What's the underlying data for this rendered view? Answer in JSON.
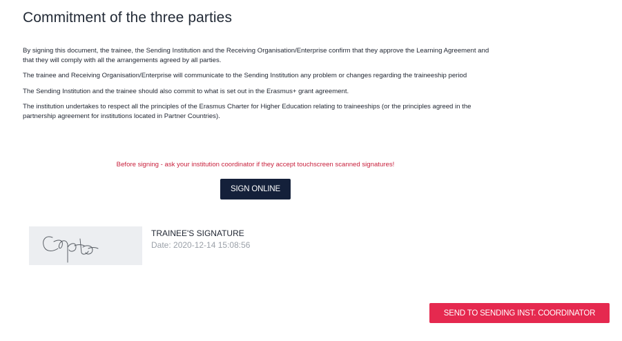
{
  "section": {
    "title": "Commitment of the three parties",
    "paragraphs": [
      "By signing this document, the trainee, the Sending Institution and the Receiving Organisation/Enterprise confirm that they approve the Learning Agreement and that they will comply with all the arrangements agreed by all parties.",
      "The trainee and Receiving Organisation/Enterprise will communicate to the Sending Institution any problem or changes regarding the traineeship period",
      "The Sending Institution and the trainee should also commit to what is set out in the Erasmus+ grant agreement.",
      "The institution undertakes to respect all the principles of the Erasmus Charter for Higher Education relating to traineeships (or the principles agreed in the partnership agreement for institutions located in Partner Countries)."
    ],
    "warning": "Before signing - ask your institution coordinator if they accept touchscreen scanned signatures!"
  },
  "actions": {
    "sign_online_label": "SIGN ONLINE",
    "send_label": "SEND TO SENDING INST. COORDINATOR"
  },
  "signature": {
    "label": "TRAINEE'S SIGNATURE",
    "date": "Date: 2020-12-14 15:08:56"
  },
  "colors": {
    "primary_dark": "#14203a",
    "danger": "#e5294f",
    "warning_text": "#c8203c"
  }
}
